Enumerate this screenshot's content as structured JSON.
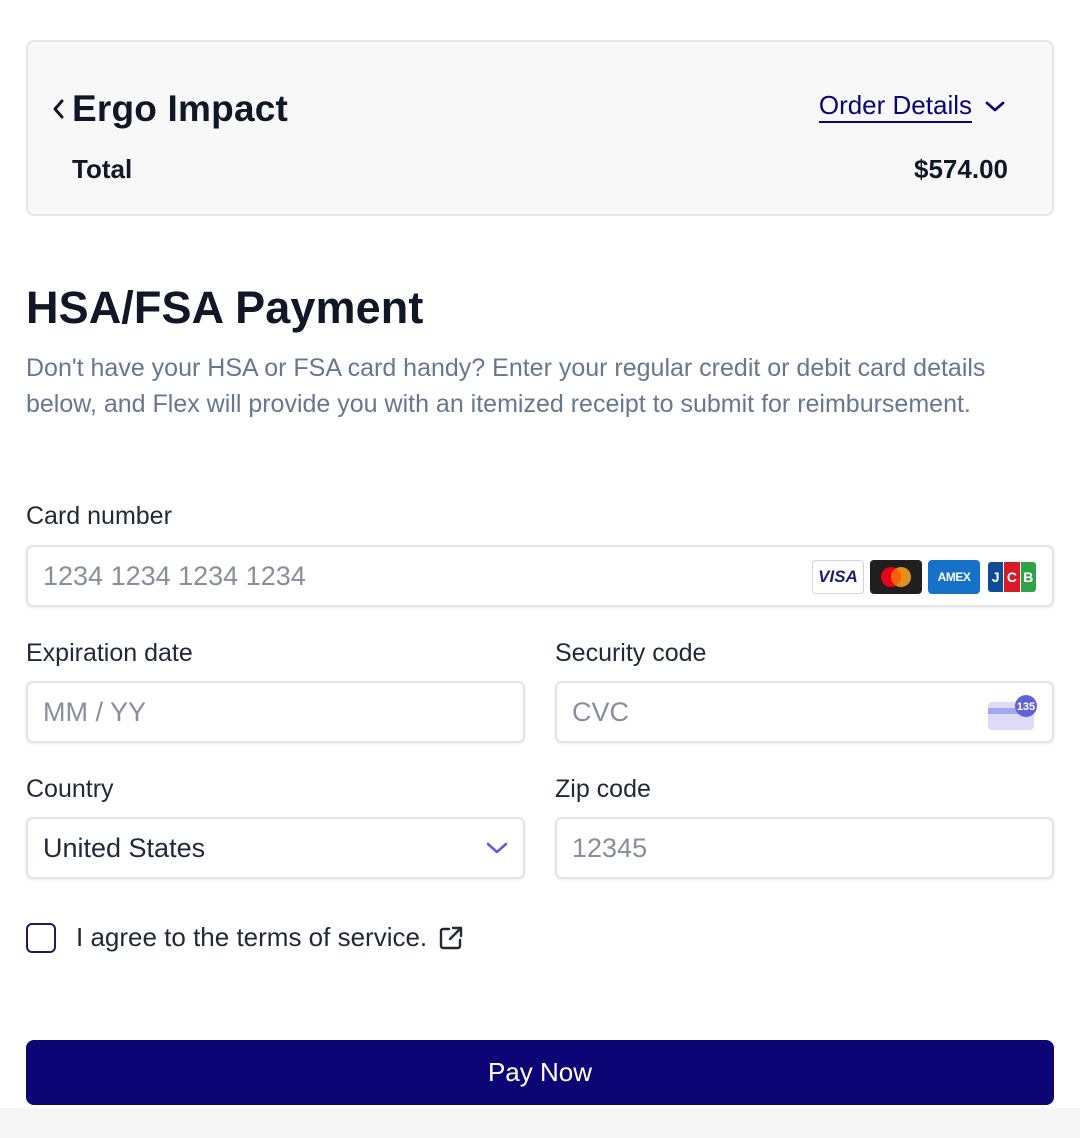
{
  "summary": {
    "merchant": "Ergo Impact",
    "order_details_label": "Order Details",
    "total_label": "Total",
    "total_value": "$574.00"
  },
  "payment": {
    "title": "HSA/FSA Payment",
    "description": "Don't have your HSA or FSA card handy? Enter your regular credit or debit card details below, and Flex will provide you with an itemized receipt to submit for reimbursement."
  },
  "form": {
    "card_number": {
      "label": "Card number",
      "placeholder": "1234 1234 1234 1234"
    },
    "card_brands": [
      "VISA",
      "Mastercard",
      "AMEX",
      "JCB"
    ],
    "expiration": {
      "label": "Expiration date",
      "placeholder": "MM / YY"
    },
    "security_code": {
      "label": "Security code",
      "placeholder": "CVC",
      "icon_text": "135"
    },
    "country": {
      "label": "Country",
      "value": "United States"
    },
    "zip": {
      "label": "Zip code",
      "placeholder": "12345"
    },
    "terms_label": "I agree to the terms of service.",
    "submit_label": "Pay Now"
  },
  "colors": {
    "brand": "#0c0575",
    "muted_text": "#667790",
    "placeholder": "#878f9c"
  }
}
